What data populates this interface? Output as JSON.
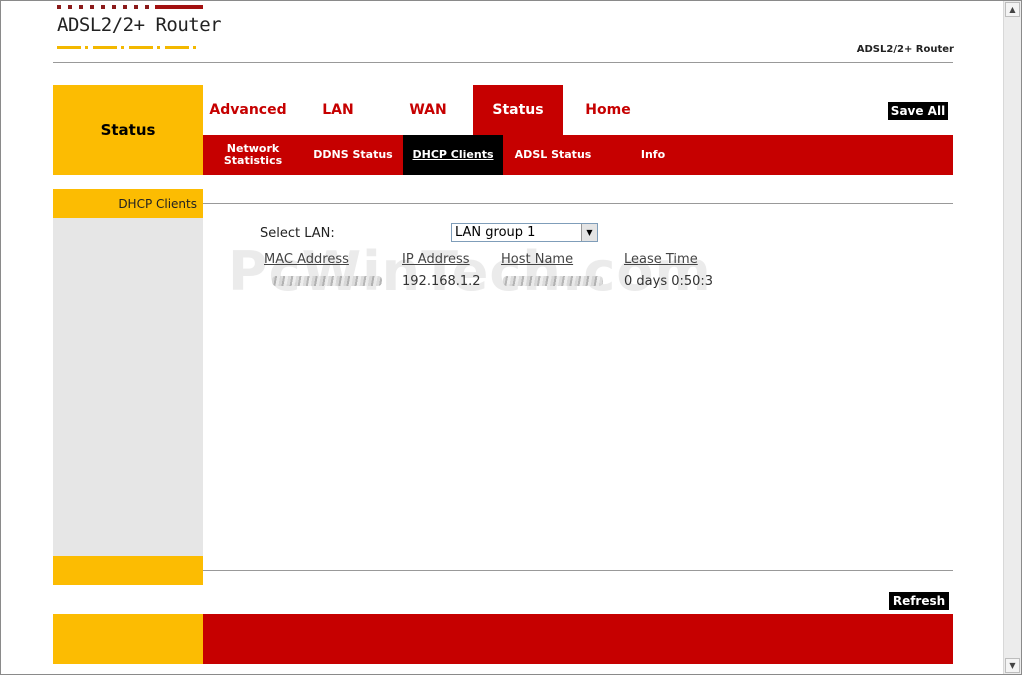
{
  "header": {
    "logo_text": "ADSL2/2+ Router",
    "right_title": "ADSL2/2+ Router"
  },
  "section": {
    "title": "Status"
  },
  "tabs": [
    {
      "label": "Advanced"
    },
    {
      "label": "LAN"
    },
    {
      "label": "WAN"
    },
    {
      "label": "Status",
      "active": true
    },
    {
      "label": "Home"
    }
  ],
  "save_all_label": "Save All",
  "subnav": [
    {
      "label": "Network Statistics"
    },
    {
      "label": "DDNS Status"
    },
    {
      "label": "DHCP Clients",
      "active": true
    },
    {
      "label": "ADSL Status"
    },
    {
      "label": "Info"
    }
  ],
  "left_panel": {
    "title": "DHCP Clients"
  },
  "content": {
    "select_lan_label": "Select LAN:",
    "select_lan_value": "LAN group 1",
    "table": {
      "headers": [
        "MAC Address",
        "IP Address",
        "Host Name",
        "Lease Time"
      ],
      "rows": [
        {
          "mac": "",
          "ip": "192.168.1.2",
          "host": "",
          "lease": "0 days 0:50:3"
        }
      ]
    }
  },
  "watermark": "PcWinTech.com",
  "refresh_label": "Refresh",
  "colors": {
    "brand_red": "#c60000",
    "brand_yellow": "#fcbc02",
    "panel_gray": "#e6e6e6"
  }
}
